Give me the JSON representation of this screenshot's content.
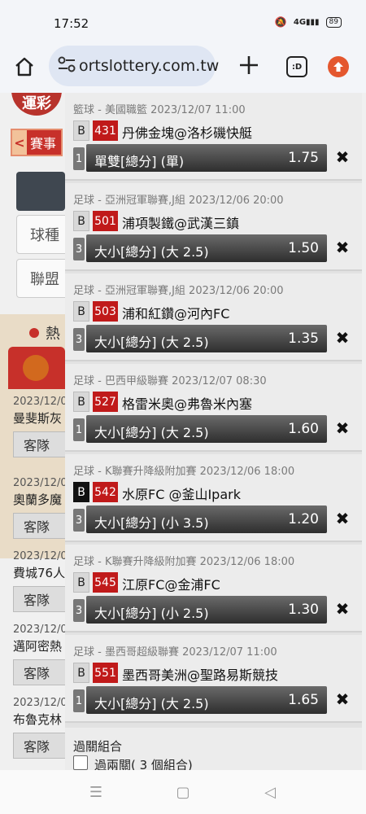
{
  "status": {
    "time": "17:52",
    "signal": "4G",
    "battery": "89"
  },
  "browser": {
    "url": "ortslottery.com.tw",
    "tabs_label": ":D"
  },
  "background": {
    "logo": "運彩",
    "tab_label": "賽事",
    "tab_arrow": "<",
    "select_sport": "球種",
    "select_league": "聯盟",
    "hot_label": "熱",
    "matches": [
      {
        "date": "2023/12/0",
        "team": "曼斐斯灰",
        "btn": "客隊"
      },
      {
        "date": "2023/12/0",
        "team": "奧蘭多魔",
        "btn": "客隊"
      },
      {
        "date": "2023/12/0",
        "team": "費城76人",
        "btn": "客隊"
      },
      {
        "date": "2023/12/0",
        "team": "邁阿密熱",
        "btn": "客隊"
      },
      {
        "date": "2023/12/0",
        "team": "布魯克林",
        "btn": "客隊"
      }
    ]
  },
  "bets": [
    {
      "league": "籃球 - 美國職籃 2023/12/07 11:00",
      "b": "B",
      "num": "431",
      "teams": "丹佛金塊@洛杉磯快艇",
      "count": "1",
      "type": "單雙[總分] (單)",
      "odds": "1.75",
      "b_dark": false
    },
    {
      "league": "足球 - 亞洲冠軍聯賽,J組 2023/12/06 20:00",
      "b": "B",
      "num": "501",
      "teams": "浦項製鐵@武漢三鎮",
      "count": "3",
      "type": "大小[總分] (大 2.5)",
      "odds": "1.50",
      "b_dark": false
    },
    {
      "league": "足球 - 亞洲冠軍聯賽,J組 2023/12/06 20:00",
      "b": "B",
      "num": "503",
      "teams": "浦和紅鑽@河內FC",
      "count": "3",
      "type": "大小[總分] (大 2.5)",
      "odds": "1.35",
      "b_dark": false
    },
    {
      "league": "足球 - 巴西甲級聯賽 2023/12/07 08:30",
      "b": "B",
      "num": "527",
      "teams": "格雷米奧@弗魯米內塞",
      "count": "1",
      "type": "大小[總分] (大 2.5)",
      "odds": "1.60",
      "b_dark": false
    },
    {
      "league": "足球 - K聯賽升降級附加賽 2023/12/06 18:00",
      "b": "B",
      "num": "542",
      "teams": "水原FC @釜山Ipark",
      "count": "3",
      "type": "大小[總分] (小 3.5)",
      "odds": "1.20",
      "b_dark": true
    },
    {
      "league": "足球 - K聯賽升降級附加賽 2023/12/06 18:00",
      "b": "B",
      "num": "545",
      "teams": "江原FC@金浦FC",
      "count": "3",
      "type": "大小[總分] (小 2.5)",
      "odds": "1.30",
      "b_dark": false
    },
    {
      "league": "足球 - 墨西哥超級聯賽 2023/12/07 11:00",
      "b": "B",
      "num": "551",
      "teams": "墨西哥美洲@聖路易斯競技",
      "count": "1",
      "type": "大小[總分] (大 2.5)",
      "odds": "1.65",
      "b_dark": false
    }
  ],
  "combo": {
    "title": "過關組合",
    "option": "過兩關( 3 個組合)"
  },
  "icons": {
    "close": "✖",
    "nav_menu": "☰",
    "nav_home": "▢",
    "nav_back": "◁"
  }
}
